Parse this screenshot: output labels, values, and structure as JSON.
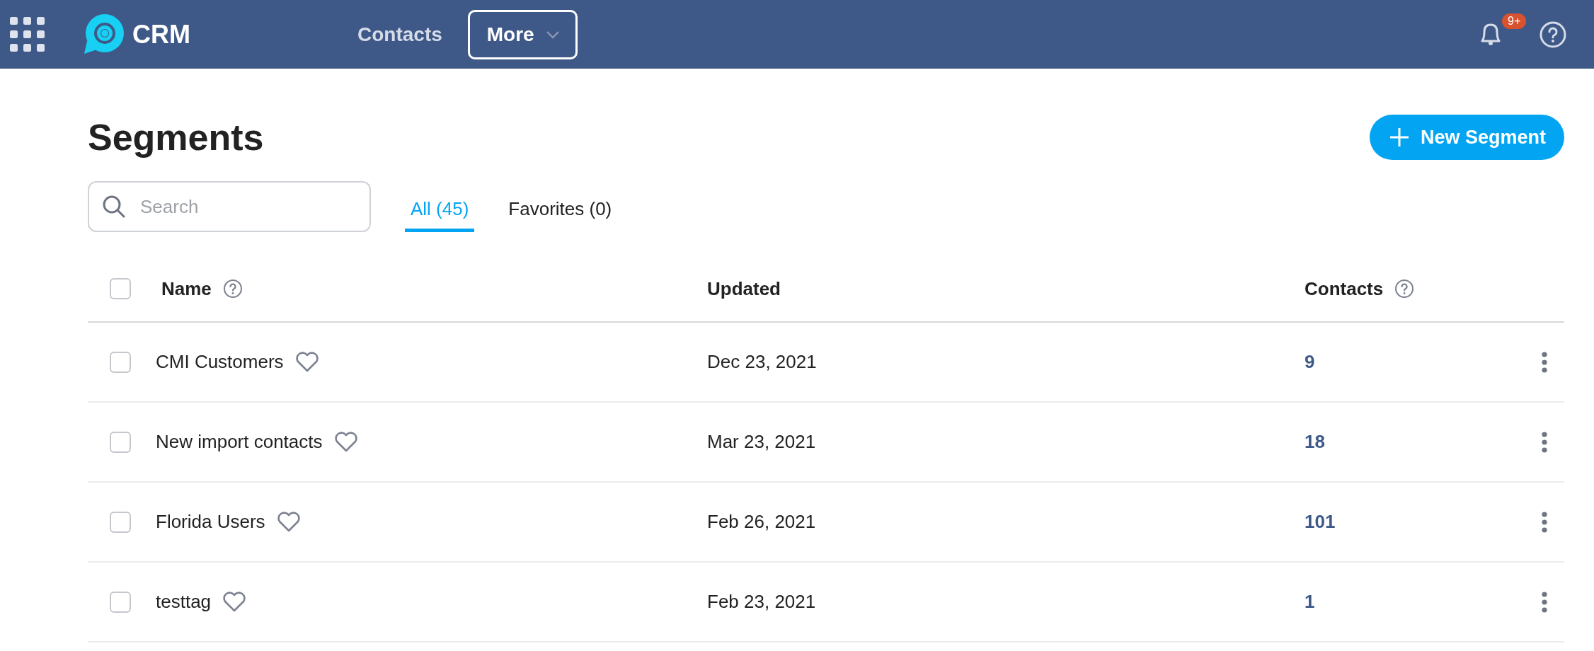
{
  "nav": {
    "app_name": "CRM",
    "links": [
      {
        "label": "Contacts",
        "kind": "link"
      },
      {
        "label": "More",
        "kind": "dropdown"
      }
    ],
    "notifications_badge": "9+"
  },
  "page": {
    "title": "Segments",
    "new_button": "New Segment"
  },
  "search": {
    "placeholder": "Search"
  },
  "tabs": [
    {
      "label": "All (45)",
      "selected": true
    },
    {
      "label": "Favorites (0)",
      "selected": false
    }
  ],
  "table": {
    "select_all_checked": false,
    "columns": [
      {
        "label": "Name",
        "help": true
      },
      {
        "label": "Updated",
        "help": false
      },
      {
        "label": "Contacts",
        "help": true
      }
    ],
    "rows": [
      {
        "name": "CMI Customers",
        "favorite": false,
        "checked": false,
        "updated": "Dec 23, 2021",
        "contacts": "9"
      },
      {
        "name": "New import contacts",
        "favorite": false,
        "checked": false,
        "updated": "Mar 23, 2021",
        "contacts": "18"
      },
      {
        "name": "Florida Users",
        "favorite": false,
        "checked": false,
        "updated": "Feb 26, 2021",
        "contacts": "101"
      },
      {
        "name": "testtag",
        "favorite": false,
        "checked": false,
        "updated": "Feb 23, 2021",
        "contacts": "1"
      }
    ]
  }
}
